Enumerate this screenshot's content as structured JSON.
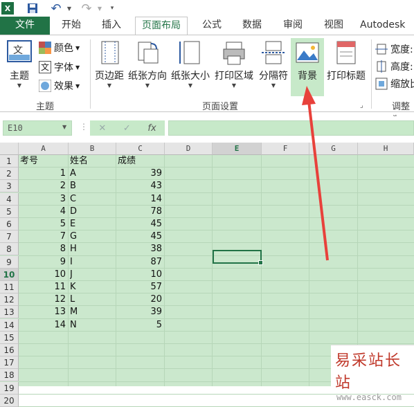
{
  "qat": {
    "excel_icon": "excel-icon",
    "save_icon": "save-icon",
    "undo_icon": "undo-icon",
    "redo_icon": "redo-icon",
    "customize_icon": "customize-qat-icon"
  },
  "tabs": [
    "文件",
    "开始",
    "插入",
    "页面布局",
    "公式",
    "数据",
    "审阅",
    "视图",
    "Autodesk"
  ],
  "active_tab": "页面布局",
  "ribbon": {
    "theme_group": {
      "label": "主题",
      "main": "主题",
      "colors": "颜色",
      "fonts": "字体",
      "effects": "效果"
    },
    "page_setup_group": {
      "label": "页面设置",
      "margins": "页边距",
      "orientation": "纸张方向",
      "size": "纸张大小",
      "print_area": "打印区域",
      "breaks": "分隔符",
      "background": "背景",
      "print_titles": "打印标题"
    },
    "scale_group": {
      "label": "调整为",
      "width": "宽度:",
      "height": "高度:",
      "scale": "缩放比"
    }
  },
  "formula_bar": {
    "name_box": "E10",
    "cancel": "✕",
    "enter": "✓",
    "fx": "fx",
    "formula": ""
  },
  "columns": [
    "A",
    "B",
    "C",
    "D",
    "E",
    "F",
    "G",
    "H"
  ],
  "selected_column": "E",
  "rows": [
    "1",
    "2",
    "3",
    "4",
    "5",
    "6",
    "7",
    "8",
    "9",
    "10",
    "11",
    "12",
    "13",
    "14",
    "15",
    "16",
    "17",
    "18",
    "19",
    "20"
  ],
  "selected_row": "10",
  "sheet": {
    "headers": [
      "考号",
      "姓名",
      "成绩"
    ],
    "data": [
      [
        "1",
        "A",
        "39"
      ],
      [
        "2",
        "B",
        "43"
      ],
      [
        "3",
        "C",
        "14"
      ],
      [
        "4",
        "D",
        "78"
      ],
      [
        "5",
        "E",
        "45"
      ],
      [
        "7",
        "G",
        "45"
      ],
      [
        "8",
        "H",
        "38"
      ],
      [
        "9",
        "I",
        "87"
      ],
      [
        "10",
        "J",
        "10"
      ],
      [
        "11",
        "K",
        "57"
      ],
      [
        "12",
        "L",
        "20"
      ],
      [
        "13",
        "M",
        "39"
      ],
      [
        "14",
        "N",
        "5"
      ]
    ],
    "row_labels": [
      "2",
      "3",
      "4",
      "5",
      "6",
      "7",
      "8",
      "9",
      "10",
      "11",
      "12",
      "13",
      "14",
      "15"
    ]
  },
  "watermark": {
    "title": "易采站长站",
    "url": "www.easck.com"
  },
  "colors": {
    "excel_green": "#217346",
    "sheet_bg": "#cbe8cd",
    "arrow": "#e8413b"
  }
}
